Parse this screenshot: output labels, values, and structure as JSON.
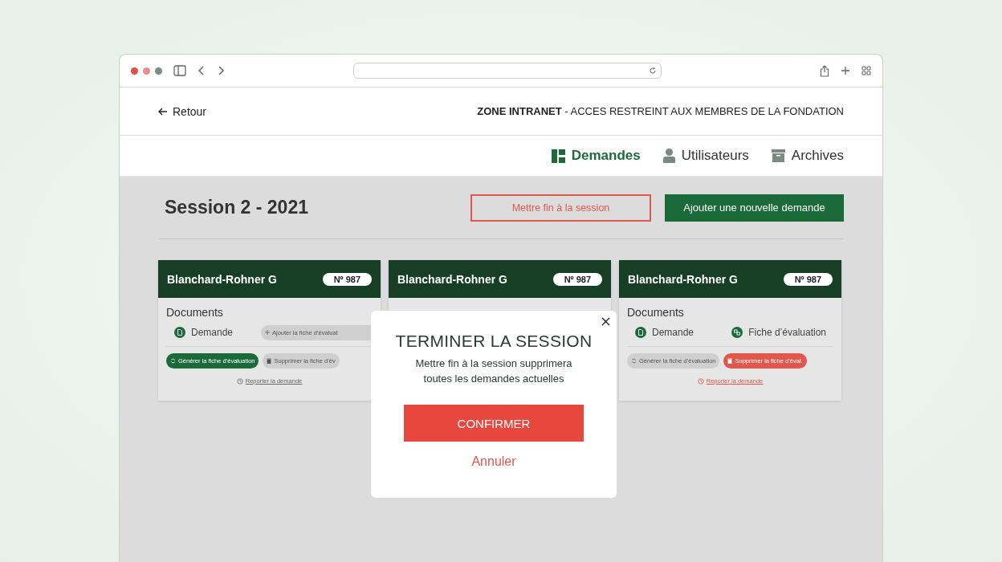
{
  "header": {
    "back_link": "Retour",
    "notice": "**ZONE INTRANET** - ACCES RESTREINT AUX MEMBRES DE LA FONDATION"
  },
  "nav": [
    {
      "label": "Demandes",
      "kind": "dashboard",
      "selected": true
    },
    {
      "label": "Utilisateurs",
      "kind": "user",
      "selected": false
    },
    {
      "label": "Archives",
      "kind": "archive",
      "selected": false
    }
  ],
  "session": {
    "title": "Session 2 - 2021",
    "end_button": "Mettre fin à la session",
    "add_button": "Ajouter une nouvelle demande"
  },
  "cards": [
    {
      "name": "Blanchard-Rohner G",
      "number": "Nº 987",
      "section": "Documents",
      "documents": [
        {
          "kind": "file",
          "label": "Demande"
        },
        {
          "kind": "add",
          "label": "Ajouter la fiche d’évaluat"
        }
      ],
      "actions": [
        {
          "kind": "generate",
          "label": "Générer la fiche d’évaluation",
          "disabled": false
        },
        {
          "kind": "delete",
          "label": "Supprimer la fiche d’év",
          "disabled": true
        }
      ],
      "report": {
        "label": "Reporter la demande",
        "active": false
      }
    },
    {
      "name": "Blanchard-Rohner G",
      "number": "Nº 987"
    },
    {
      "name": "Blanchard-Rohner G",
      "number": "Nº 987",
      "section": "Documents",
      "documents": [
        {
          "kind": "file",
          "label": "Demande"
        },
        {
          "kind": "evaluation",
          "label": "Fiche d’évaluation"
        }
      ],
      "actions": [
        {
          "kind": "generate",
          "label": "Générer la fiche d’évaluation",
          "disabled": true
        },
        {
          "kind": "delete",
          "label": "Supprimer la fiche d’éval.",
          "disabled": false
        }
      ],
      "report": {
        "label": "Reporter la demande",
        "active": true
      }
    }
  ],
  "dialog": {
    "title": "TERMINER LA SESSION",
    "message": "Mettre fin à la session supprimera toutes les demandes actuelles",
    "confirm": "CONFIRMER",
    "cancel": "Annuler"
  }
}
